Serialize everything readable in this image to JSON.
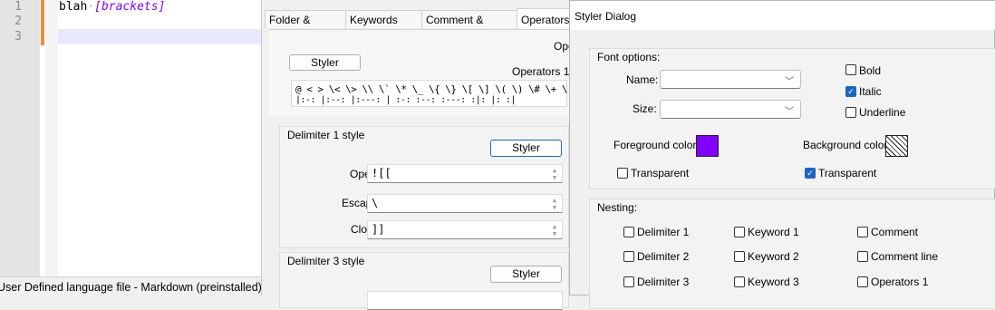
{
  "editor": {
    "line_numbers": [
      "1",
      "2",
      "3"
    ],
    "line1_word": "blah",
    "line1_space": "·",
    "line1_brackets": "[brackets]"
  },
  "status": {
    "text": "User Defined language file - Markdown (preinstalled)"
  },
  "udl": {
    "tabs": [
      "Folder & Default",
      "Keywords Lists",
      "Comment & Number",
      "Operators"
    ],
    "open_partial": "Ope",
    "styler_label": "Styler",
    "operators1_label": "Operators 1",
    "operators_line1": "@ < > \\< \\> \\\\ \\` \\* \\_ \\{ \\} \\[ \\] \\( \\) \\# \\+ \\- \\. \\! \\~ \\|",
    "operators_line2": "|:-: |:--: |:---: | :-: :--: :---: :|: |: :|",
    "delim1": {
      "title": "Delimiter 1 style",
      "styler": "Styler",
      "open_label": "Open:",
      "open_value": "![[",
      "escape_label": "Escape:",
      "escape_value": "\\",
      "close_label": "Close:",
      "close_value": "]]"
    },
    "delim3": {
      "title": "Delimiter 3 style",
      "styler": "Styler"
    }
  },
  "dialog": {
    "title": "Styler Dialog",
    "font_options": "Font options:",
    "name_label": "Name:",
    "size_label": "Size:",
    "bold": "Bold",
    "italic": "Italic",
    "underline": "Underline",
    "bold_checked": false,
    "italic_checked": true,
    "underline_checked": false,
    "fg_label": "Foreground color:",
    "bg_label": "Background color:",
    "fg_color": "#8000ff",
    "transparent": "Transparent",
    "fg_transparent_checked": false,
    "bg_transparent_checked": true,
    "nesting": "Nesting:",
    "nesting_items": [
      [
        "Delimiter 1",
        "Keyword 1",
        "Comment"
      ],
      [
        "Delimiter 2",
        "Keyword 2",
        "Comment line"
      ],
      [
        "Delimiter 3",
        "Keyword 3",
        "Operators 1"
      ]
    ]
  }
}
